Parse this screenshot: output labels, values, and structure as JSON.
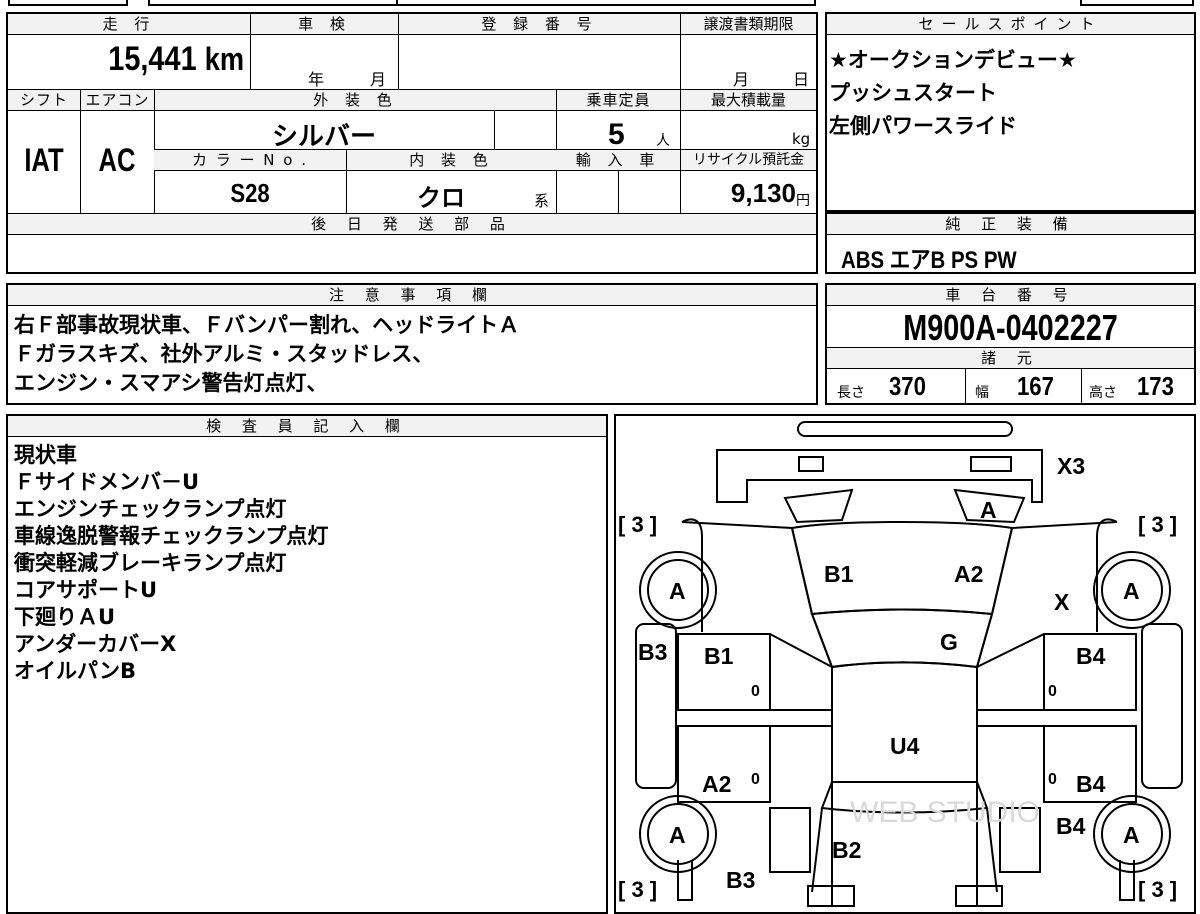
{
  "top": {
    "mileage_label": "走 行",
    "mileage": "15,441",
    "mileage_unit": "km",
    "inspection_label": "車 検",
    "inspection_year_unit": "年",
    "inspection_month_unit": "月",
    "registration_label": "登 録 番 号",
    "transfer_label": "譲渡書類期限",
    "transfer_month_unit": "月",
    "transfer_day_unit": "日"
  },
  "spec": {
    "shift_label": "シフト",
    "shift": "IAT",
    "ac_label": "エアコン",
    "ac": "AC",
    "exterior_label": "外 装 色",
    "exterior": "シルバー",
    "capacity_label": "乗車定員",
    "capacity": "5",
    "capacity_unit": "人",
    "max_load_label": "最大積載量",
    "max_load_unit": "kg",
    "color_no_label": "カ ラ ー N o .",
    "color_no": "S28",
    "interior_label": "内 装 色",
    "interior": "クロ",
    "interior_suffix": "系",
    "import_label": "輸 入 車",
    "recycle_label": "リサイクル預託金",
    "recycle": "9,130",
    "recycle_unit": "円",
    "later_parts_label": "後 日 発 送 部 品"
  },
  "sales": {
    "label": "セールスポイント",
    "lines": [
      "★オークションデビュー★",
      "プッシュスタート",
      "左側パワースライド"
    ]
  },
  "equipment": {
    "label": "純 正 装 備",
    "value": "ABS エアB PS PW"
  },
  "notes": {
    "label": "注 意 事 項 欄",
    "lines": [
      "右Ｆ部事故現状車、Ｆバンパー割れ、ヘッドライトＡ",
      " Ｆガラスキズ、社外アルミ・スタッドレス、",
      "エンジン・スマアシ警告灯点灯、"
    ]
  },
  "chassis": {
    "label": "車 台 番 号",
    "number": "M900A-0402227",
    "specs_label": "諸 元",
    "length_label": "長さ",
    "length": "370",
    "width_label": "幅",
    "width": "167",
    "height_label": "高さ",
    "height": "173"
  },
  "inspector": {
    "label": "検 査 員 記 入 欄",
    "lines": [
      "現状車",
      "Ｆサイドメンバ－U",
      "エンジンチェックランプ点灯",
      "車線逸脱警報チェックランプ点灯",
      "衝突軽減ブレーキランプ点灯",
      "コアサポートU",
      "下廻りＡU",
      "アンダーカバーX",
      "オイルパンB"
    ]
  },
  "diagram": {
    "marks": {
      "x3": "X3",
      "a_top": "A",
      "b1_hood": "B1",
      "a2_hood": "A2",
      "g": "G",
      "x_right": "X",
      "b3_left": "B3",
      "b1_door": "B1",
      "b4_door": "B4",
      "u4": "U4",
      "a2_rear": "A2",
      "b4_rear": "B4",
      "b4_quarter": "B4",
      "b2": "B2",
      "b3_bottom": "B3"
    },
    "tire_mark": "A",
    "tread": "[ 3 ]",
    "zero": "0",
    "watermark": "WEB STUDIO"
  }
}
